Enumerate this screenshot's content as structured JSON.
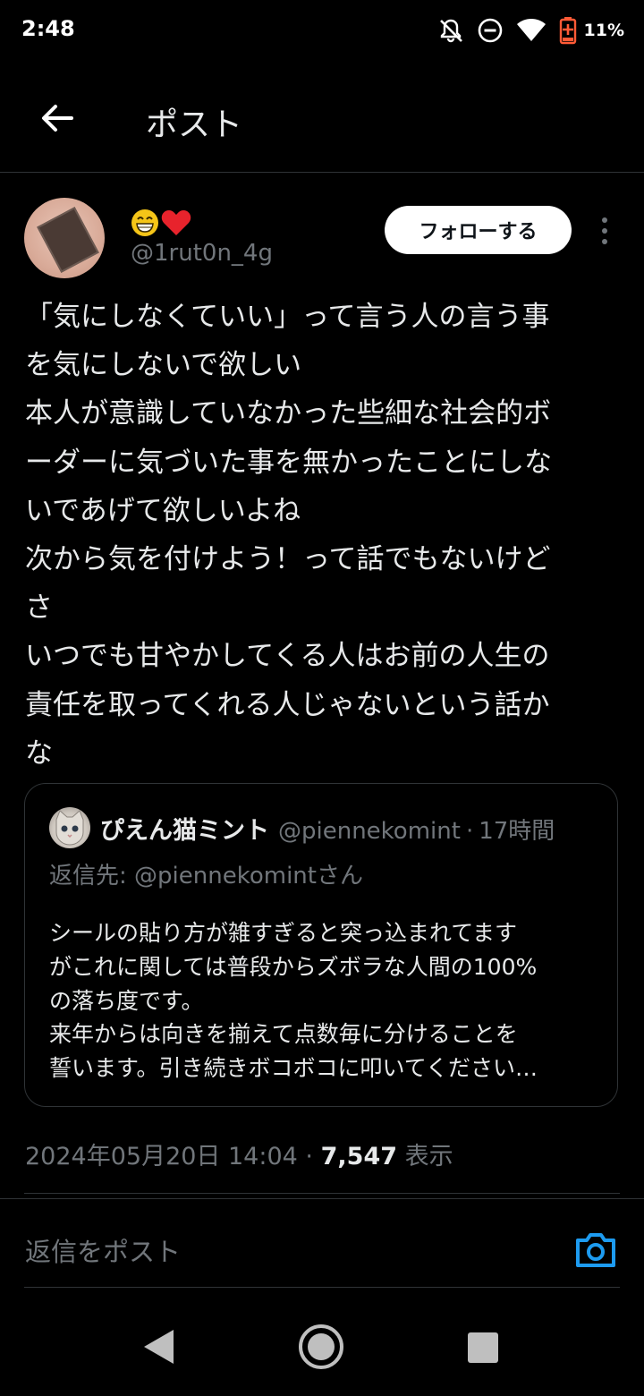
{
  "status_bar": {
    "time": "2:48",
    "battery": "11%",
    "icons": [
      "notifications-off-icon",
      "do-not-disturb-icon",
      "wifi-icon",
      "battery-charging-icon"
    ]
  },
  "header": {
    "title": "ポスト"
  },
  "author": {
    "display_name_emoji": "😁❤️",
    "handle": "@1rut0n_4g",
    "follow_label": "フォローする"
  },
  "post": {
    "lines": [
      "「気にしなくていい」って言う人の言う事",
      "を気にしないで欲しい",
      "本人が意識していなかった些細な社会的ボ",
      "ーダーに気づいた事を無かったことにしな",
      "いであげて欲しいよね",
      "次から気を付けよう！って話でもないけど",
      "さ",
      "いつでも甘やかしてくる人はお前の人生の",
      "責任を取ってくれる人じゃないという話か",
      "な"
    ]
  },
  "quote": {
    "name": "ぴえん猫ミント",
    "handle": "@piennekomint",
    "separator": "·",
    "time": "17時間",
    "reply_to": "返信先: @piennekomintさん",
    "lines": [
      "シールの貼り方が雑すぎると突っ込まれてます",
      "がこれに関しては普段からズボラな人間の100%",
      "の落ち度です。",
      "来年からは向きを揃えて点数毎に分けることを",
      "誓います。引き続きボコボコに叩いてください…"
    ]
  },
  "meta": {
    "datetime": "2024年05月20日 14:04",
    "separator": "·",
    "views": "7,547",
    "views_label": "表示"
  },
  "reply": {
    "placeholder": "返信をポスト"
  },
  "colors": {
    "background": "#000000",
    "text": "#e7e9ea",
    "secondary": "#71767b",
    "accent": "#1d9bf0",
    "divider": "#2f3336"
  }
}
